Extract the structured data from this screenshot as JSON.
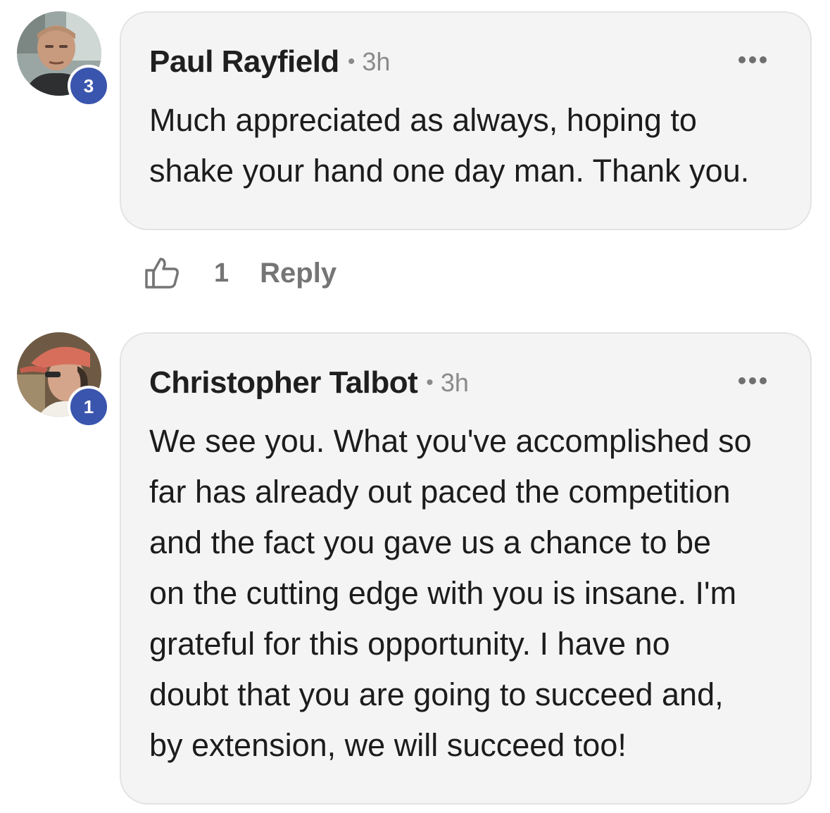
{
  "comments": [
    {
      "author": "Paul Rayfield",
      "separator": "•",
      "time": "3h",
      "badge": "3",
      "text": "Much appreciated as always, hoping to\nshake your hand one day man. Thank you.",
      "icon": "more-options-icon"
    },
    {
      "author": "Christopher Talbot",
      "separator": "•",
      "time": "3h",
      "badge": "1",
      "text": "We see you. What you've accomplished so\nfar has already out paced the competition\nand the fact you gave us a chance to be\non the cutting edge with you is insane. I'm\ngrateful for this opportunity. I have no\ndoubt that you are going to succeed and,\nby extension, we will succeed too!",
      "icon": "more-options-icon"
    }
  ],
  "actions": {
    "like_icon": "thumbs-up-icon",
    "like_count": "1",
    "reply_label": "Reply"
  },
  "colors": {
    "badge": "#3a55ad",
    "bubble": "#f5f4f4",
    "bubble_border": "#e3e3e3",
    "muted_text": "#757575"
  }
}
